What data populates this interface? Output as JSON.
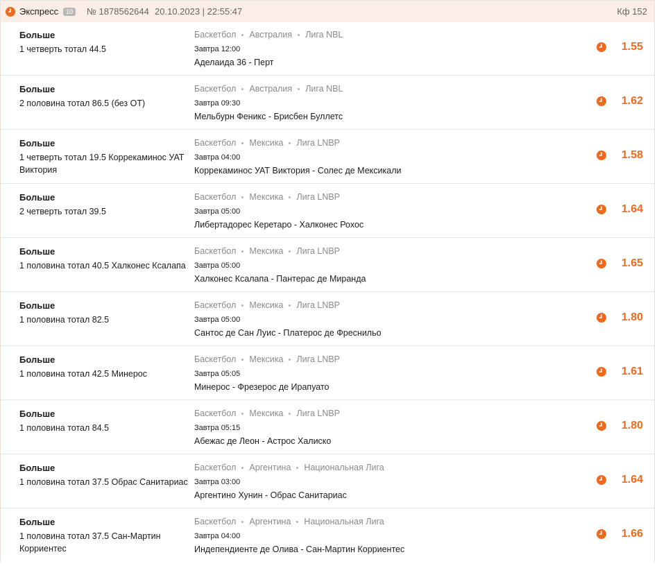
{
  "header": {
    "title": "Экспресс",
    "count": "10",
    "number": "№ 1878562644",
    "datetime": "20.10.2023 | 22:55:47",
    "total_odds": "Кф 152",
    "status_icon": "clock-icon",
    "accent_color": "#ef6a1c"
  },
  "bets": [
    {
      "outcome": "Больше",
      "market": "1 четверть тотал 44.5",
      "sport": "Баскетбол",
      "country": "Австралия",
      "league": "Лига NBL",
      "time": "Завтра 12:00",
      "match": "Аделаида 36 - Перт",
      "odds": "1.55"
    },
    {
      "outcome": "Больше",
      "market": "2 половина тотал 86.5 (без ОТ)",
      "sport": "Баскетбол",
      "country": "Австралия",
      "league": "Лига NBL",
      "time": "Завтра 09:30",
      "match": "Мельбурн Феникс - Брисбен Буллетс",
      "odds": "1.62"
    },
    {
      "outcome": "Больше",
      "market": "1 четверть тотал 19.5 Коррекаминос УАТ Виктория",
      "sport": "Баскетбол",
      "country": "Мексика",
      "league": "Лига LNBP",
      "time": "Завтра 04:00",
      "match": "Коррекаминос УАТ Виктория - Солес де Мексикали",
      "odds": "1.58"
    },
    {
      "outcome": "Больше",
      "market": "2 четверть тотал 39.5",
      "sport": "Баскетбол",
      "country": "Мексика",
      "league": "Лига LNBP",
      "time": "Завтра 05:00",
      "match": "Либертадорес Керетаро - Халконес Рохос",
      "odds": "1.64"
    },
    {
      "outcome": "Больше",
      "market": "1 половина тотал 40.5 Халконес Ксалапа",
      "sport": "Баскетбол",
      "country": "Мексика",
      "league": "Лига LNBP",
      "time": "Завтра 05:00",
      "match": "Халконес Ксалапа - Пантерас де Миранда",
      "odds": "1.65"
    },
    {
      "outcome": "Больше",
      "market": "1 половина тотал 82.5",
      "sport": "Баскетбол",
      "country": "Мексика",
      "league": "Лига LNBP",
      "time": "Завтра 05:00",
      "match": "Сантос де Сан Луис - Платерос де Фреснильо",
      "odds": "1.80"
    },
    {
      "outcome": "Больше",
      "market": "1 половина тотал 42.5 Минерос",
      "sport": "Баскетбол",
      "country": "Мексика",
      "league": "Лига LNBP",
      "time": "Завтра 05:05",
      "match": "Минерос - Фрезерос де Ирапуато",
      "odds": "1.61"
    },
    {
      "outcome": "Больше",
      "market": "1 половина тотал 84.5",
      "sport": "Баскетбол",
      "country": "Мексика",
      "league": "Лига LNBP",
      "time": "Завтра 05:15",
      "match": "Абежас де Леон - Астрос Халиско",
      "odds": "1.80"
    },
    {
      "outcome": "Больше",
      "market": "1 половина тотал 37.5 Обрас Санитариас",
      "sport": "Баскетбол",
      "country": "Аргентина",
      "league": "Национальная Лига",
      "time": "Завтра 03:00",
      "match": "Аргентино Хунин - Обрас Санитариас",
      "odds": "1.64"
    },
    {
      "outcome": "Больше",
      "market": "1 половина тотал 37.5 Сан-Мартин Корриентес",
      "sport": "Баскетбол",
      "country": "Аргентина",
      "league": "Национальная Лига",
      "time": "Завтра 04:00",
      "match": "Индепендиенте де Олива - Сан-Мартин Корриентес",
      "odds": "1.66"
    }
  ]
}
